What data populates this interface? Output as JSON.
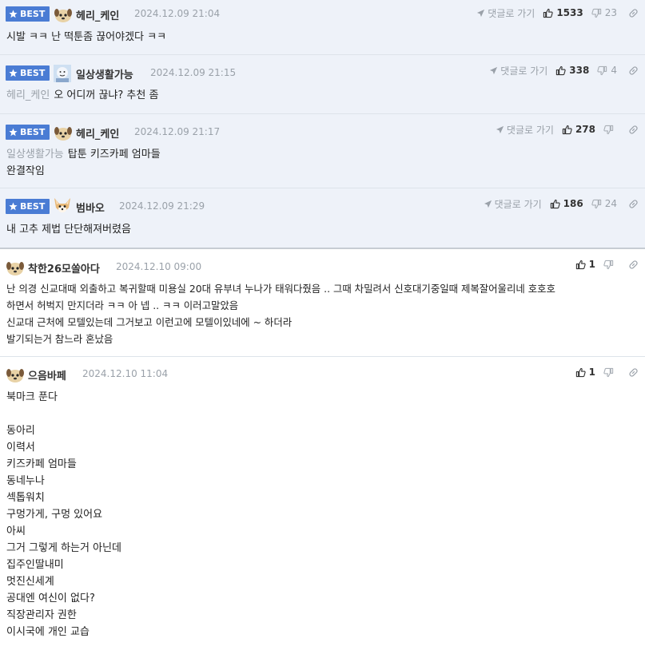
{
  "ui": {
    "best_label": "BEST",
    "reply_link_label": "댓글로 가기",
    "colors": {
      "best_bg": "#eef2f9",
      "badge_bg": "#4a7cd4",
      "muted": "#9aa1a9",
      "text": "#222222"
    }
  },
  "comments": [
    {
      "best": true,
      "avatar": "dog-avatar",
      "nickname": "헤리_케인",
      "date": "2024.12.09 21:04",
      "likes": "1533",
      "dislikes": "23",
      "mention": "",
      "lines": [
        "시발 ㅋㅋ 난 떡툰좀 끊어야겠다 ㅋㅋ"
      ]
    },
    {
      "best": true,
      "avatar": "face-avatar",
      "nickname": "일상생활가능",
      "date": "2024.12.09 21:15",
      "likes": "338",
      "dislikes": "4",
      "mention": "헤리_케인",
      "lines": [
        "오 어디꺼 끊냐? 추천 좀"
      ]
    },
    {
      "best": true,
      "avatar": "dog-avatar",
      "nickname": "헤리_케인",
      "date": "2024.12.09 21:17",
      "likes": "278",
      "dislikes": "",
      "mention": "일상생활가능",
      "lines": [
        "탑툰 키즈카페 엄마들",
        "완결작임"
      ]
    },
    {
      "best": true,
      "avatar": "fox-avatar",
      "nickname": "범바오",
      "date": "2024.12.09 21:29",
      "likes": "186",
      "dislikes": "24",
      "mention": "",
      "lines": [
        "내 고추 제법 단단해져버렸음"
      ]
    },
    {
      "best": false,
      "avatar": "dog-avatar",
      "nickname": "착한26모쏠아다",
      "date": "2024.12.10 09:00",
      "likes": "1",
      "dislikes": "",
      "mention": "",
      "lines": [
        "난 의경 신교대때 외출하고 복귀할때 미용실 20대 유부녀 누나가 태워다줬음 .. 그때 차밀려서 신호대기중일때 제복잘어울리네 호호호",
        "하면서 허벅지 만지더라 ㅋㅋ 아 넵 .. ㅋㅋ 이러고말았음",
        "신교대 근처에 모텔있는데 그거보고 이런고에 모텔이있네에 ~ 하더라",
        "발기되는거 참느라 혼났음"
      ]
    },
    {
      "best": false,
      "avatar": "dog-avatar",
      "nickname": "으음바페",
      "date": "2024.12.10 11:04",
      "likes": "1",
      "dislikes": "",
      "mention": "",
      "lines": [
        "북마크 푼다",
        "",
        "동아리",
        "이력서",
        "키즈카페 엄마들",
        "동네누나",
        "섹톱워치",
        "구멍가게, 구멍 있어요",
        "아씨",
        "그거 그렇게 하는거 아닌데",
        "집주인딸내미",
        "멋진신세계",
        "공대엔 여신이 없다?",
        "직장관리자 권한",
        "이시국에 개인 교습"
      ]
    }
  ]
}
